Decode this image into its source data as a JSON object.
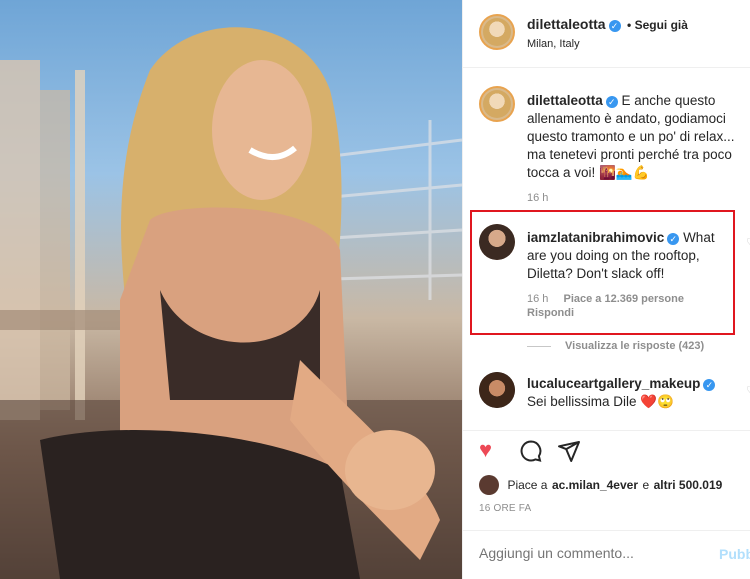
{
  "header": {
    "username": "dilettaleotta",
    "follow_label": "• Segui già",
    "location": "Milan, Italy"
  },
  "caption": {
    "username": "dilettaleotta",
    "text": "E anche questo allenamento è andato, godiamoci questo tramonto e un po' di relax... ma tenetevi pronti perché tra poco tocca a voi! 🌇🏊💪",
    "time": "16 h"
  },
  "comments": [
    {
      "username": "iamzlatanibrahimovic",
      "text": "What are you doing on the rooftop, Diletta? Don't slack off!",
      "time": "16 h",
      "likes": "Piace a 12.369 persone",
      "reply": "Rispondi",
      "view_replies": "Visualizza le risposte (423)"
    },
    {
      "username": "lucaluceartgallery_makeup",
      "text": "Sei bellissima Dile ❤️🙄"
    }
  ],
  "likes": {
    "prefix": "Piace a",
    "user": "ac.milan_4ever",
    "suffix": "e",
    "others": "altri 500.019"
  },
  "timestamp": "16 ORE FA",
  "add_comment": {
    "placeholder": "Aggiungi un commento...",
    "publish": "Pubb"
  },
  "colors": {
    "highlight": "#e0161f",
    "like_red": "#ed4956",
    "verified_blue": "#3897f0"
  },
  "icons": {
    "like": "heart-filled-icon",
    "comment": "speech-bubble-icon",
    "share": "paper-plane-icon",
    "verified": "verified-badge-icon"
  }
}
